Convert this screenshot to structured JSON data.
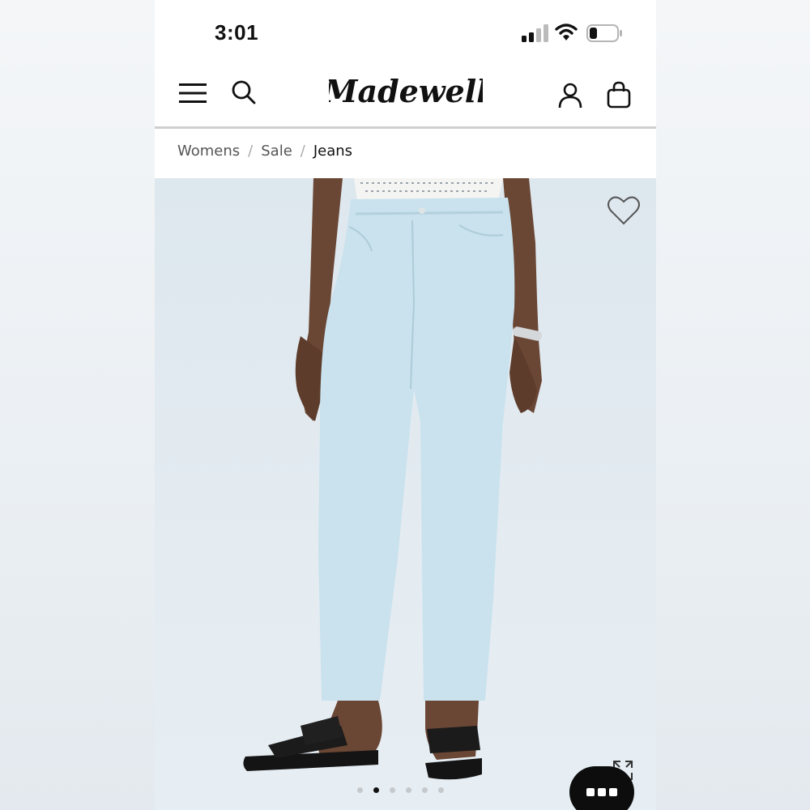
{
  "status_bar": {
    "time": "3:01",
    "icons": [
      "cellular-signal-icon",
      "wifi-icon",
      "battery-icon"
    ]
  },
  "header": {
    "logo_text": "Madewell",
    "left_icons": [
      "menu-icon",
      "search-icon"
    ],
    "right_icons": [
      "account-icon",
      "shopping-bag-icon"
    ]
  },
  "breadcrumb": {
    "items": [
      "Womens",
      "Sale",
      "Jeans"
    ],
    "separator": "/"
  },
  "product_gallery": {
    "icons": [
      "heart-icon",
      "expand-icon"
    ],
    "total_images": 6,
    "active_image_index": 1
  },
  "chat": {
    "icon": "chat-bubble-icon"
  },
  "colors": {
    "text_primary": "#111111",
    "text_secondary": "#555555",
    "image_background": "#e1e9ef",
    "denim": "#c9e2ee",
    "chat_button": "#0d0d0d"
  }
}
